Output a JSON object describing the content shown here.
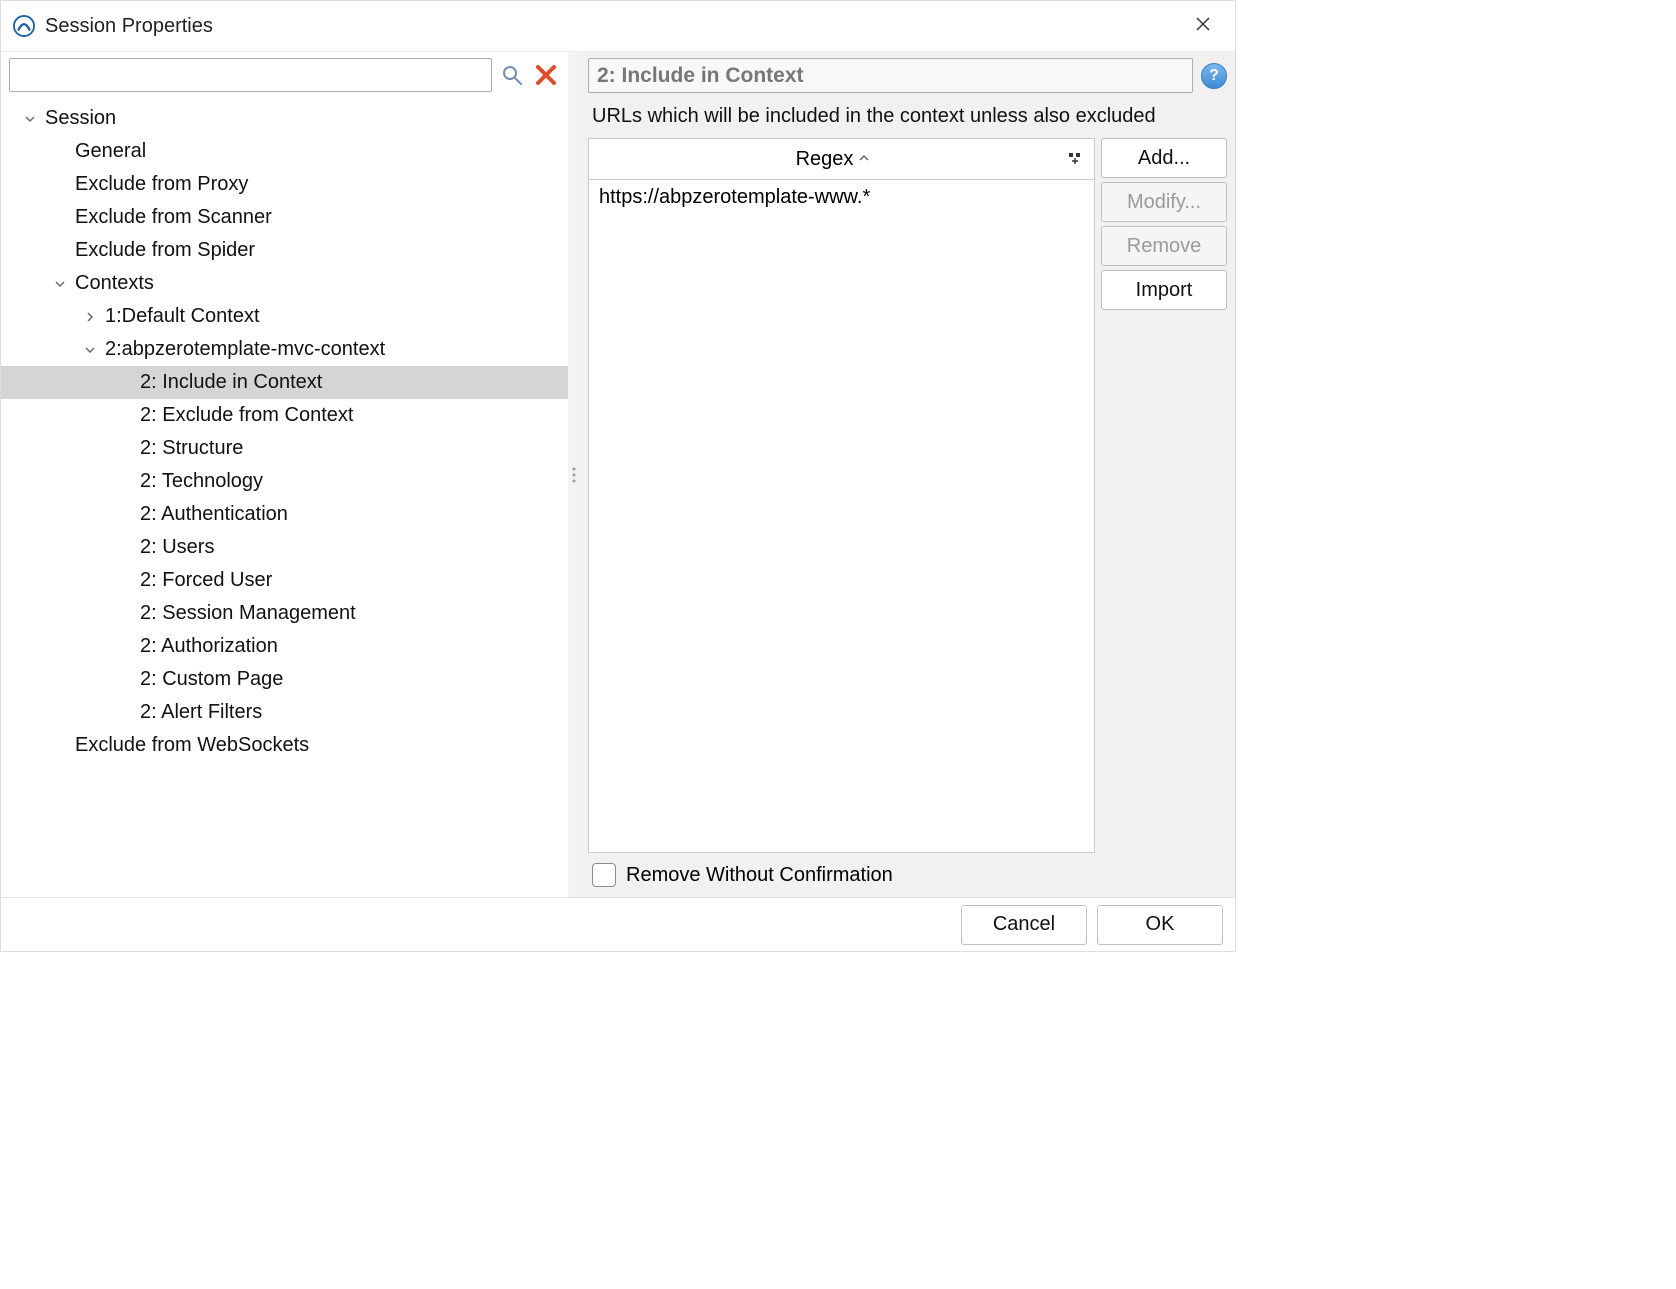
{
  "titlebar": {
    "title": "Session Properties"
  },
  "search": {
    "value": ""
  },
  "tree": {
    "session": "Session",
    "general": "General",
    "exclude_proxy": "Exclude from Proxy",
    "exclude_scanner": "Exclude from Scanner",
    "exclude_spider": "Exclude from Spider",
    "contexts": "Contexts",
    "ctx1": "1:Default Context",
    "ctx2": "2:abpzerotemplate-mvc-context",
    "ctx2_include": "2: Include in Context",
    "ctx2_exclude": "2: Exclude from Context",
    "ctx2_structure": "2: Structure",
    "ctx2_technology": "2: Technology",
    "ctx2_auth": "2: Authentication",
    "ctx2_users": "2: Users",
    "ctx2_forced": "2: Forced User",
    "ctx2_sessmgmt": "2: Session Management",
    "ctx2_authz": "2: Authorization",
    "ctx2_custom": "2: Custom Page",
    "ctx2_alert": "2: Alert Filters",
    "exclude_ws": "Exclude from WebSockets"
  },
  "panel": {
    "title": "2: Include in Context",
    "description": "URLs which will be included in the context unless also excluded",
    "column": "Regex",
    "rows": [
      "https://abpzerotemplate-www.*"
    ],
    "buttons": {
      "add": "Add...",
      "modify": "Modify...",
      "remove": "Remove",
      "import": "Import"
    },
    "remove_confirm": "Remove Without Confirmation"
  },
  "footer": {
    "cancel": "Cancel",
    "ok": "OK"
  }
}
